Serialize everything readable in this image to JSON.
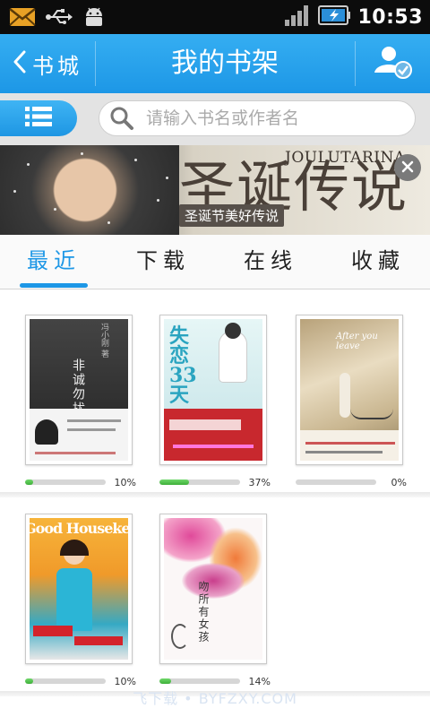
{
  "status_bar": {
    "time": "10:53",
    "icons": [
      "mail-icon",
      "usb-icon",
      "android-debug-icon",
      "signal-icon",
      "battery-charging-icon"
    ]
  },
  "header": {
    "back_label": "书城",
    "title": "我的书架",
    "user_icon": "user-check-icon",
    "accent_color": "#1d97e6"
  },
  "search": {
    "placeholder": "请输入书名或作者名"
  },
  "banner": {
    "title": "圣诞传说",
    "english": "JOULUTARINA",
    "tagline": "圣诞节美好传说"
  },
  "tabs": [
    {
      "label": "最近",
      "active": true
    },
    {
      "label": "下载",
      "active": false
    },
    {
      "label": "在线",
      "active": false
    },
    {
      "label": "收藏",
      "active": false
    }
  ],
  "books": [
    {
      "cover_title": "非诚勿扰",
      "cover_author": "冯小刚 著",
      "progress_label": "10%",
      "progress": 0.1
    },
    {
      "cover_title": "失恋33天",
      "cover_author": "鲍鲸鲸 著",
      "progress_label": "37%",
      "progress": 0.37
    },
    {
      "cover_title": "After you leave",
      "cover_author": "",
      "progress_label": "0%",
      "progress": 0.0
    },
    {
      "cover_title": "Good Housekeeping",
      "cover_author": "",
      "progress_label": "10%",
      "progress": 0.1
    },
    {
      "cover_title": "吻所有女孩",
      "cover_author": "",
      "progress_label": "14%",
      "progress": 0.14
    }
  ],
  "watermark": "飞下载 • BYFZXY.COM"
}
